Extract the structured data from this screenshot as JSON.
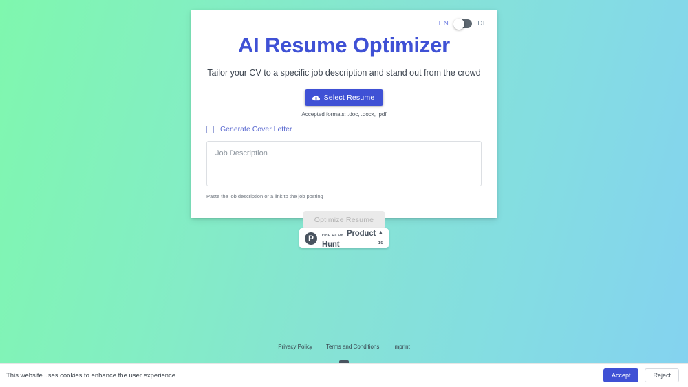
{
  "app": {
    "title": "AI Resume Optimizer",
    "subtitle": "Tailor your CV to a specific job description and stand out from the crowd",
    "brand_color": "#3f51d5",
    "background_from": "#7ff7ae",
    "background_to": "#84d2f0"
  },
  "language_toggle": {
    "left_label": "EN",
    "right_label": "DE",
    "state": "left",
    "knob_icon": "toggle-knob"
  },
  "upload": {
    "button_label": "Select Resume",
    "button_icon": "cloud-upload-icon",
    "accepted_formats": "Accepted formats: .doc, .docx, .pdf"
  },
  "cover_letter": {
    "label": "Generate Cover Letter",
    "checked": false
  },
  "job_description": {
    "placeholder": "Job Description",
    "value": "",
    "help_text": "Paste the job description or a link to the job posting"
  },
  "optimize": {
    "label": "Optimize Resume",
    "disabled": true
  },
  "product_hunt": {
    "kicker": "FIND US ON",
    "name": "Product Hunt",
    "logo_letter": "P",
    "logo_icon": "product-hunt-logo",
    "upvote_icon": "▲",
    "upvote_count": "10"
  },
  "footer": {
    "links": [
      {
        "label": "Privacy Policy"
      },
      {
        "label": "Terms and Conditions"
      },
      {
        "label": "Imprint"
      }
    ]
  },
  "cookie_banner": {
    "message": "This website uses cookies to enhance the user experience.",
    "accept_label": "Accept",
    "reject_label": "Reject"
  }
}
